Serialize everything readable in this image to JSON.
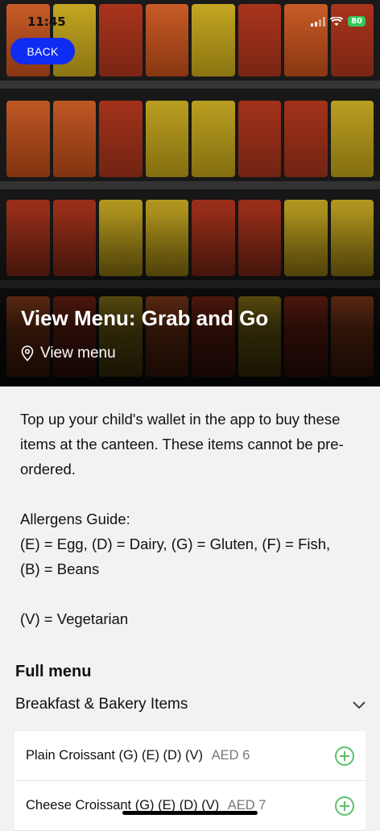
{
  "status_bar": {
    "time": "11:45",
    "battery": "80"
  },
  "nav": {
    "back_label": "BACK"
  },
  "hero": {
    "title": "View Menu: Grab and Go",
    "link_label": "View menu"
  },
  "intro": {
    "paragraph": "Top up your child's wallet in the app to buy these items at the canteen. These items cannot be pre-ordered.",
    "allergens_heading": "Allergens Guide:",
    "allergens_line1": "(E) = Egg, (D) = Dairy, (G) = Gluten, (F) = Fish,",
    "allergens_line2": "(B) = Beans",
    "vegetarian": "(V) = Vegetarian"
  },
  "menu": {
    "heading": "Full menu",
    "section": "Breakfast & Bakery Items",
    "items": [
      {
        "name": "Plain Croissant (G) (E) (D) (V)",
        "price": "AED 6"
      },
      {
        "name": "Cheese Croissant (G) (E) (D) (V)",
        "price": "AED 7"
      }
    ]
  },
  "colors": {
    "accent": "#0f2cf2",
    "add": "#5cbf6a"
  }
}
